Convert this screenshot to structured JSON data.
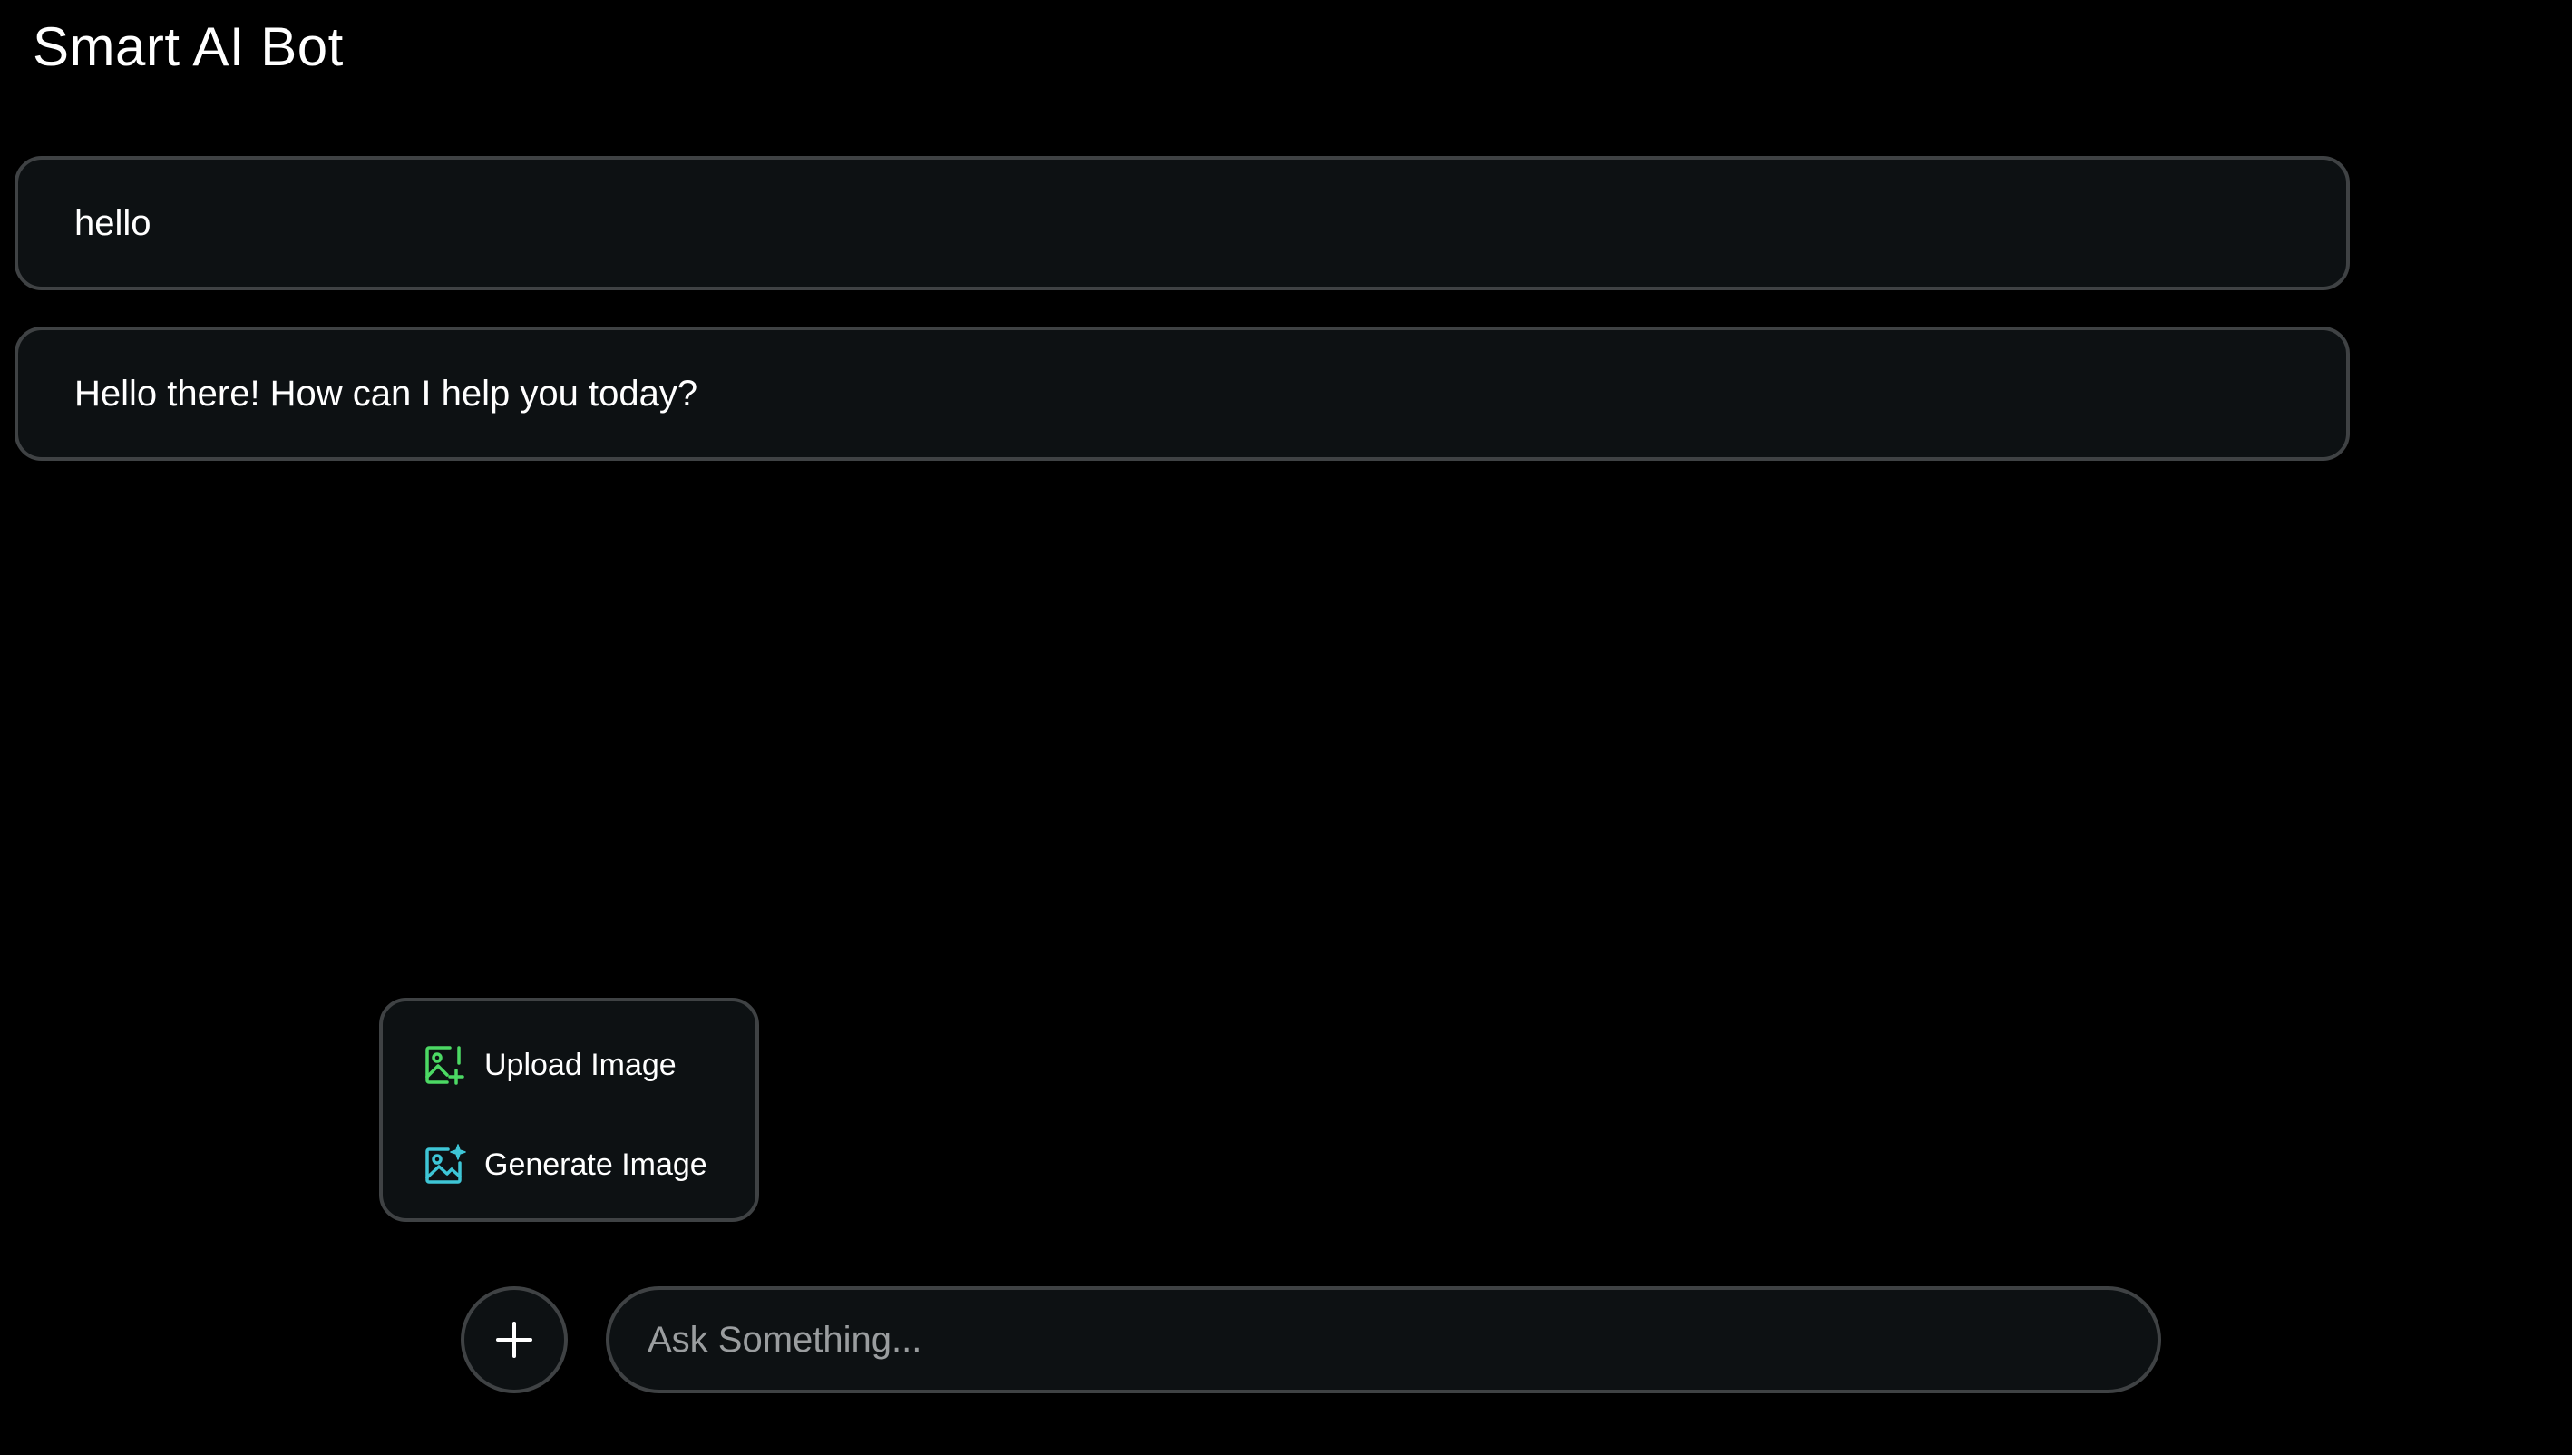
{
  "header": {
    "title": "Smart AI Bot"
  },
  "messages": [
    {
      "role": "user",
      "text": "hello"
    },
    {
      "role": "bot",
      "text": "Hello there! How can I help you today?"
    }
  ],
  "attach_menu": {
    "items": [
      {
        "label": "Upload Image",
        "icon": "upload-image-icon",
        "color": "#4cd964"
      },
      {
        "label": "Generate Image",
        "icon": "generate-image-icon",
        "color": "#3ec6d6"
      }
    ]
  },
  "composer": {
    "add_button_icon": "plus-icon",
    "input_value": "",
    "input_placeholder": "Ask Something..."
  },
  "colors": {
    "background": "#000000",
    "panel": "#0d1113",
    "border": "#3f4244",
    "text": "#ffffff",
    "placeholder": "#9a9d9f"
  }
}
